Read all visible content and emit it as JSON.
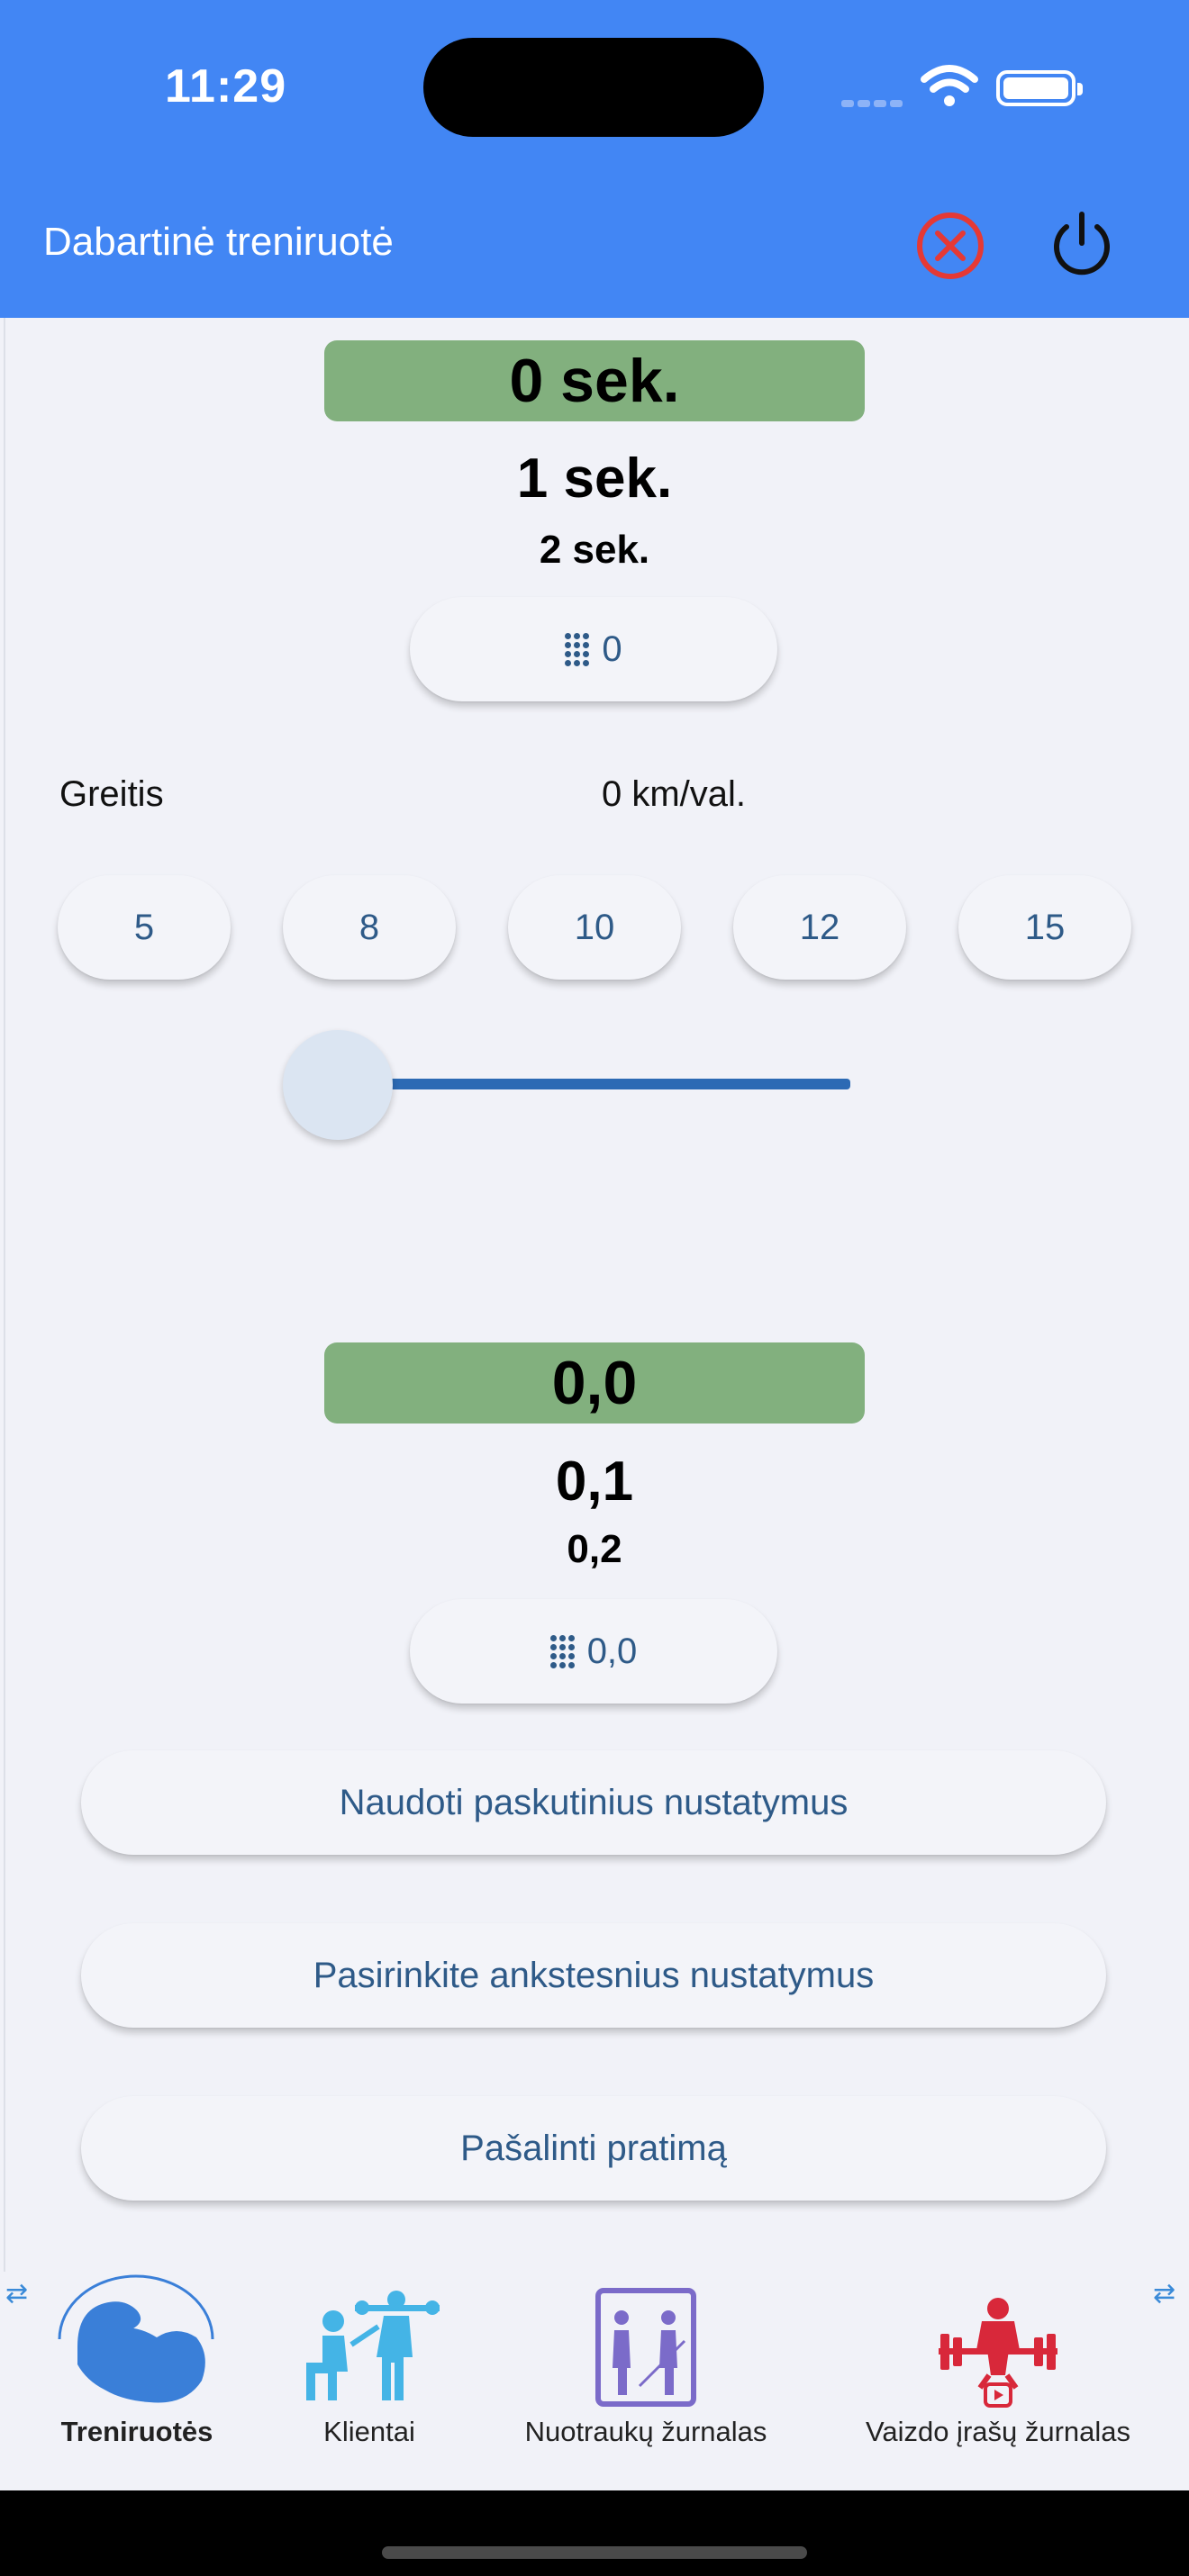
{
  "status_bar": {
    "time": "11:29"
  },
  "app_bar": {
    "title": "Dabartinė treniruotė"
  },
  "time_picker": {
    "selected": "0 sek.",
    "next": "1 sek.",
    "next2": "2 sek.",
    "keypad_value": "0"
  },
  "speed": {
    "label": "Greitis",
    "value": "0 km/val.",
    "presets": [
      "5",
      "8",
      "10",
      "12",
      "15"
    ],
    "slider_fraction": 0
  },
  "value_picker": {
    "selected": "0,0",
    "next": "0,1",
    "next2": "0,2",
    "keypad_value": "0,0"
  },
  "actions": {
    "use_last": "Naudoti paskutinius nustatymus",
    "choose_previous": "Pasirinkite ankstesnius nustatymus",
    "remove_exercise": "Pašalinti pratimą"
  },
  "bottom_nav": {
    "items": [
      {
        "label": "Treniruotės",
        "icon": "bicep-icon",
        "active": true
      },
      {
        "label": "Klientai",
        "icon": "trainer-client-icon",
        "active": false
      },
      {
        "label": "Nuotraukų žurnalas",
        "icon": "mirror-photo-icon",
        "active": false
      },
      {
        "label": "Vaizdo įrašų žurnalas",
        "icon": "weightlifter-video-icon",
        "active": false
      }
    ]
  },
  "colors": {
    "app_bar": "#4286f4",
    "picker_highlight": "#82b07e",
    "accent_text": "#2e5a88",
    "close_red": "#e53935"
  }
}
